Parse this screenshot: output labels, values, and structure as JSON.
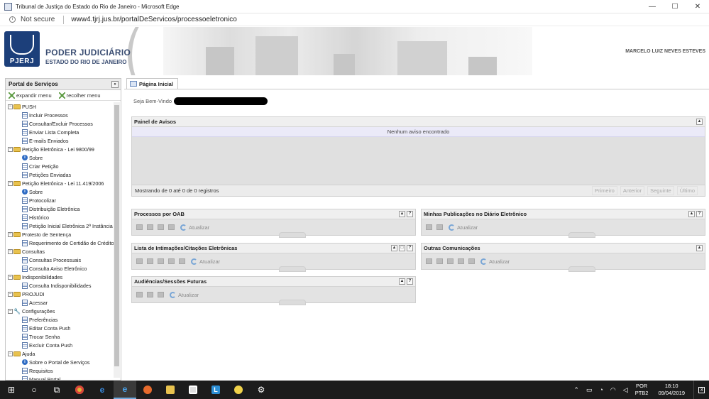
{
  "window": {
    "title": "Tribunal de Justiça do Estado do Rio de Janeiro - Microsoft Edge",
    "controls": [
      "—",
      "☐",
      "✕"
    ]
  },
  "address": {
    "security": "Not secure",
    "url": "www4.tjrj.jus.br/portalDeServicos/processoeletronico"
  },
  "banner": {
    "logo_text": "PJERJ",
    "org_name": "PODER JUDICIÁRIO",
    "org_sub": "ESTADO DO RIO DE JANEIRO",
    "user_name": "MARCELO LUIZ NEVES ESTEVES"
  },
  "sidebar": {
    "title": "Portal de Serviços",
    "expand_label": "expandir menu",
    "collapse_label": "recolher menu",
    "tree": [
      {
        "label": "PUSH",
        "kind": "folder",
        "items": [
          {
            "label": "Incluir Processos",
            "icon": "doc"
          },
          {
            "label": "Consultar/Excluir Processos",
            "icon": "doc"
          },
          {
            "label": "Enviar Lista Completa",
            "icon": "doc"
          },
          {
            "label": "E-mails Enviados",
            "icon": "doc"
          }
        ]
      },
      {
        "label": "Petição Eletrônica - Lei 9800/99",
        "kind": "folder",
        "items": [
          {
            "label": "Sobre",
            "icon": "info"
          },
          {
            "label": "Criar Petição",
            "icon": "doc"
          },
          {
            "label": "Petições Enviadas",
            "icon": "doc"
          }
        ]
      },
      {
        "label": "Petição Eletrônica - Lei 11.419/2006",
        "kind": "folder",
        "items": [
          {
            "label": "Sobre",
            "icon": "info"
          },
          {
            "label": "Protocolizar",
            "icon": "doc"
          },
          {
            "label": "Distribuição Eletrônica",
            "icon": "doc"
          },
          {
            "label": "Histórico",
            "icon": "doc"
          },
          {
            "label": "Petição Inicial Eletrônica 2ª Instância",
            "icon": "doc"
          }
        ]
      },
      {
        "label": "Protesto de Sentença",
        "kind": "folder",
        "items": [
          {
            "label": "Requerimento de Certidão de Crédito",
            "icon": "doc"
          }
        ]
      },
      {
        "label": "Consultas",
        "kind": "folder",
        "items": [
          {
            "label": "Consultas Processuais",
            "icon": "doc"
          },
          {
            "label": "Consulta Aviso Eletrônico",
            "icon": "doc"
          }
        ]
      },
      {
        "label": "Indisponibilidades",
        "kind": "folder",
        "items": [
          {
            "label": "Consulta Indisponibilidades",
            "icon": "doc"
          }
        ]
      },
      {
        "label": "PROJUDI",
        "kind": "folder",
        "items": [
          {
            "label": "Acessar",
            "icon": "doc"
          }
        ]
      },
      {
        "label": "Configurações",
        "kind": "wrench",
        "items": [
          {
            "label": "Preferências",
            "icon": "doc"
          },
          {
            "label": "Editar Conta Push",
            "icon": "doc"
          },
          {
            "label": "Trocar Senha",
            "icon": "doc"
          },
          {
            "label": "Excluir Conta Push",
            "icon": "doc"
          }
        ]
      },
      {
        "label": "Ajuda",
        "kind": "folder",
        "items": [
          {
            "label": "Sobre o Portal de Serviços",
            "icon": "info"
          },
          {
            "label": "Requisitos",
            "icon": "doc"
          },
          {
            "label": "Manual Portal",
            "icon": "doc"
          }
        ]
      }
    ]
  },
  "main": {
    "tab_label": "Página Inicial",
    "welcome": "Seja Bem-Vindo",
    "avisos": {
      "title": "Painel de Avisos",
      "empty": "Nenhum aviso encontrado",
      "status": "Mostrando de 0 até 0 de 0 registros",
      "pager": [
        "Primeiro",
        "Anterior",
        "Seguinte",
        "Último"
      ]
    },
    "refresh_label": "Atualizar",
    "panels": {
      "oab": {
        "title": "Processos por OAB"
      },
      "publicacoes": {
        "title": "Minhas Publicações no Diário Eletrônico"
      },
      "intimacoes": {
        "title": "Lista de Intimações/Citações Eletrônicas"
      },
      "comunicacoes": {
        "title": "Outras Comunicações"
      },
      "audiencias": {
        "title": "Audiências/Sessões Futuras"
      }
    }
  },
  "taskbar": {
    "lang_top": "POR",
    "lang_bottom": "PTB2",
    "time": "18:10",
    "date": "09/04/2019",
    "notifications": "3"
  }
}
